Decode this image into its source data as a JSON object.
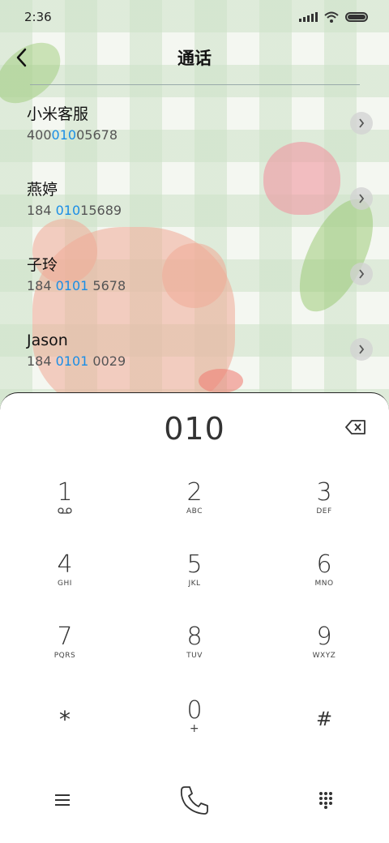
{
  "status_bar": {
    "time": "2:36"
  },
  "header": {
    "title": "通话"
  },
  "contacts": [
    {
      "name": "小米客服",
      "number_pre": "400",
      "number_match": "010",
      "number_post": "05678"
    },
    {
      "name": "燕婷",
      "number_pre": "184 ",
      "number_match": "010",
      "number_post": "15689"
    },
    {
      "name": "子玲",
      "number_pre": "184 ",
      "number_match": "0101",
      "number_post": " 5678"
    },
    {
      "name": "Jason",
      "number_pre": "184 ",
      "number_match": "0101",
      "number_post": " 0029"
    }
  ],
  "dialer": {
    "display": "010",
    "keys": [
      {
        "num": "1",
        "sub": ""
      },
      {
        "num": "2",
        "sub": "ABC"
      },
      {
        "num": "3",
        "sub": "DEF"
      },
      {
        "num": "4",
        "sub": "GHI"
      },
      {
        "num": "5",
        "sub": "JKL"
      },
      {
        "num": "6",
        "sub": "MNO"
      },
      {
        "num": "7",
        "sub": "PQRS"
      },
      {
        "num": "8",
        "sub": "TUV"
      },
      {
        "num": "9",
        "sub": "WXYZ"
      },
      {
        "num": "*",
        "sub": ""
      },
      {
        "num": "0",
        "sub": "+"
      },
      {
        "num": "#",
        "sub": ""
      }
    ]
  },
  "colors": {
    "accent": "#1a8ee6",
    "text": "#222222"
  }
}
